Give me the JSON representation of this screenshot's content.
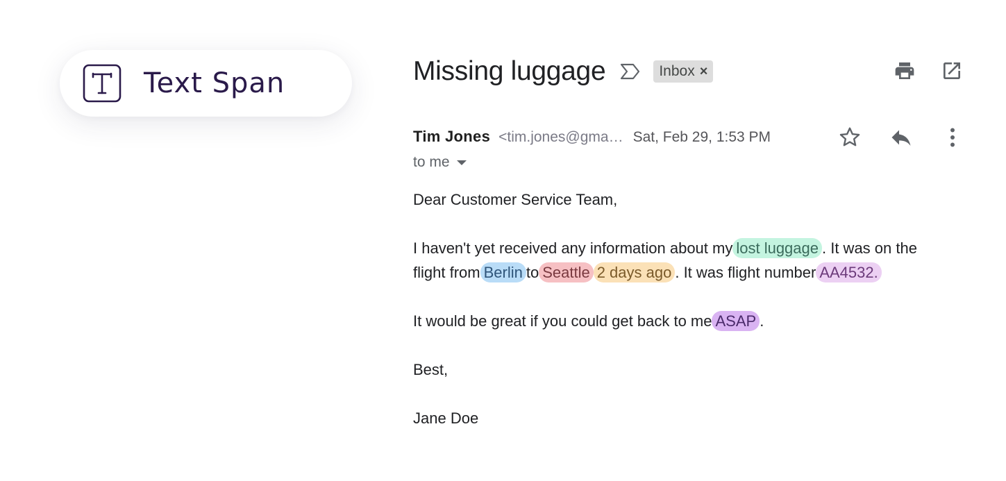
{
  "tool_card": {
    "label": "Text Span",
    "icon": "text-span-icon"
  },
  "email": {
    "subject": "Missing luggage",
    "label_chip": "Inbox",
    "label_chip_close": "×",
    "sender_name": "Tim Jones",
    "sender_email": "<tim.jones@gma…",
    "date": "Sat, Feb 29, 1:53 PM",
    "recipient": "to me",
    "icons": {
      "importance": "importance-marker-icon",
      "print": "print-icon",
      "open_new_window": "open-in-new-window-icon",
      "star": "star-icon",
      "reply": "reply-icon",
      "more": "more-vert-icon"
    },
    "body": {
      "greeting": "Dear Customer Service Team,",
      "p1_a": "I haven't yet received any information about my",
      "p1_hl_item": "lost luggage",
      "p1_b": ". It was on the",
      "p1_c": "flight from",
      "p1_hl_origin": "Berlin",
      "p1_d": "to",
      "p1_hl_destination": "Seattle",
      "p1_hl_time": "2 days ago",
      "p1_e": ". It was flight number",
      "p1_hl_flight": "AA4532.",
      "p2_a": "It would be great if you could get back to me",
      "p2_hl_urgency": "ASAP",
      "p2_b": ".",
      "signoff": "Best,",
      "signature": "Jane Doe"
    }
  },
  "colors": {
    "highlight_green": "#c4f4e0",
    "highlight_blue": "#b9dcf7",
    "highlight_red": "#f6c0c3",
    "highlight_orange": "#fbe1b7",
    "highlight_lilac": "#ecd0f3",
    "highlight_purple": "#d9b3f2",
    "tool_label": "#2a1a4a"
  }
}
